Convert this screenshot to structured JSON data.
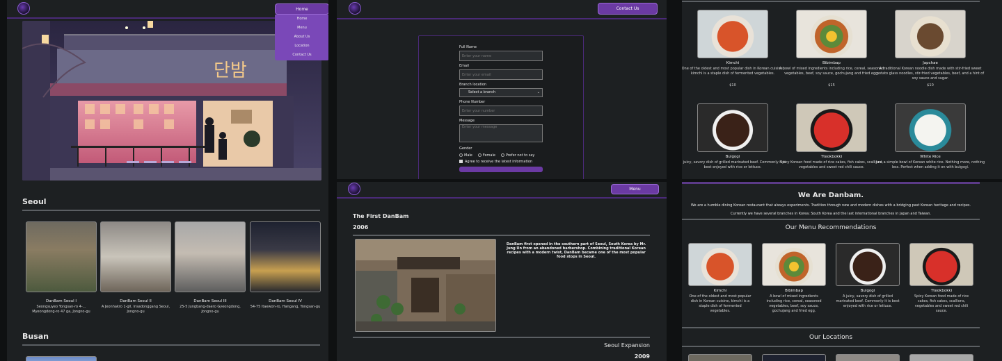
{
  "locations_page": {
    "nav": {
      "active_label": "Home",
      "dropdown": [
        "Home",
        "Menu",
        "About Us",
        "Location",
        "Contact Us"
      ]
    },
    "hero_sign": "단밤",
    "sections": [
      {
        "title": "Seoul",
        "stores": [
          {
            "name": "DanBam Seoul I",
            "address": "Seongsuyeo Yongsan-ro 4-... Myeongdong-ro 47 ga, Jongno-gu"
          },
          {
            "name": "DanBam Seoul II",
            "address": "A Jeonhakro 1-gil, Insadonggang Seoul, Jongno-gu"
          },
          {
            "name": "DanBam Seoul III",
            "address": "25-5 Jungbang-daero Gyeongdong, Jongno-gu"
          },
          {
            "name": "DanBam Seoul IV",
            "address": "54-75 Itaewon-ro, Hangang, Yongsan-gu"
          }
        ]
      },
      {
        "title": "Busan",
        "stores": []
      }
    ]
  },
  "contact_page": {
    "contact_button": "Contact Us",
    "form": {
      "full_name_label": "Full Name",
      "full_name_placeholder": "Enter your name",
      "email_label": "Email",
      "email_placeholder": "Enter your email",
      "branch_label": "Branch location",
      "branch_value": "Select a branch",
      "phone_label": "Phone Number",
      "phone_placeholder": "Enter your number",
      "message_label": "Message",
      "message_placeholder": "Enter your message",
      "gender_label": "Gender",
      "gender_options": [
        "Male",
        "Female",
        "Prefer not to say"
      ],
      "agree_label": "Agree to receive the latest information"
    }
  },
  "menu_page": {
    "items": [
      {
        "name": "Kimchi",
        "desc": "One of the oldest and most popular dish in Korean cuisine, kimchi is a staple dish of fermented vegetables.",
        "price": "$10"
      },
      {
        "name": "Bibimbap",
        "desc": "A bowl of mixed ingredients including rice, cereal, seasoned vegetables, beef, soy sauce, gochujang and fried egg.",
        "price": "$15"
      },
      {
        "name": "Japchae",
        "desc": "A traditional Korean noodle dish made with stir-fried sweet potato glass noodles, stir-fried vegetables, beef, and a hint of soy sauce and sugar.",
        "price": "$10"
      },
      {
        "name": "Bulgogi",
        "desc": "A juicy, savory dish of grilled marinated beef. Commonly it is best enjoyed with rice or lettuce."
      },
      {
        "name": "Tteokbokki",
        "desc": "Spicy Korean food made of rice cakes, fish cakes, scallions, vegetables and sweet red chili sauce."
      },
      {
        "name": "White Rice",
        "desc": "Just a simple bowl of Korean white rice. Nothing more, nothing less. Perfect when adding it on with bulgogi."
      }
    ]
  },
  "about_page": {
    "menu_button": "Menu",
    "first_title": "The First DanBam",
    "first_year": "2006",
    "first_text": "DanBam first opened in the southern part of Seoul, South Korea by Mr. Jung Un from an abandoned barbershop. Combining traditional Korean recipes with a modern twist, DanBam became one of the most popular food stops in Seoul.",
    "expansion_title": "Seoul Expansion",
    "expansion_year": "2009"
  },
  "home_page": {
    "heading": "We Are Danbam.",
    "intro_1": "We are a humble dining Korean restaurant that always experiments. Tradition through new and modern dishes with a bridging past Korean heritage and recipes.",
    "intro_2": "Currently we have several branches in Korea: South Korea and the last international branches in Japan and Taiwan.",
    "recs_title": "Our Menu Recommendations",
    "recs": [
      {
        "name": "Kimchi",
        "desc": "One of the oldest and most popular dish in Korean cuisine, kimchi is a staple dish of fermented vegetables."
      },
      {
        "name": "Bibimbap",
        "desc": "A bowl of mixed ingredients including rice, cereal, seasoned vegetables, beef, soy sauce, gochujang and fried egg."
      },
      {
        "name": "Bulgogi",
        "desc": "A juicy, savory dish of grilled marinated beef. Commonly it is best enjoyed with rice or lettuce."
      },
      {
        "name": "Tteokbokki",
        "desc": "Spicy Korean food made of rice cakes, fish cakes, scallions, vegetables and sweet red chili sauce."
      }
    ],
    "locations_title": "Our Locations"
  },
  "colors": {
    "accent": "#6b3aa3",
    "panel": "#1d2022",
    "divider": "#5b5f63"
  }
}
